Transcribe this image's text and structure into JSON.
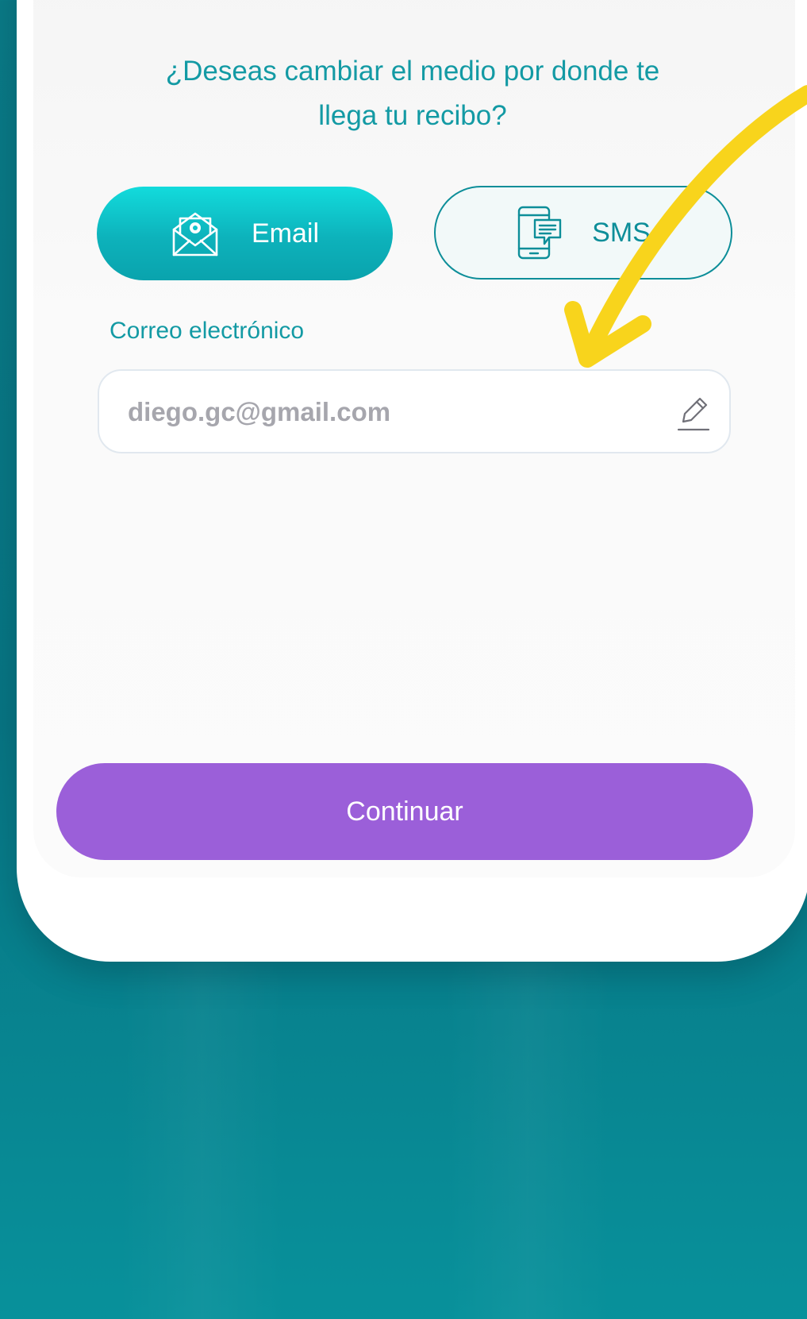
{
  "question": {
    "line1": "¿Deseas cambiar el medio por donde te",
    "line2": "llega tu recibo?"
  },
  "options": {
    "email_label": "Email",
    "sms_label": "SMS",
    "selected": "Email"
  },
  "email_field": {
    "label": "Correo electrónico",
    "value": "diego.gc@gmail.com",
    "placeholder": "diego.gc@gmail.com"
  },
  "actions": {
    "continue_label": "Continuar"
  },
  "colors": {
    "teal_text": "#139aa4",
    "teal_button": "#0db2bb",
    "purple_button": "#9b5fd9",
    "annotation_arrow": "#f8d41c",
    "background": "#077583"
  },
  "icons": {
    "email": "envelope-at-icon",
    "sms": "phone-message-icon",
    "edit": "pencil-icon"
  }
}
